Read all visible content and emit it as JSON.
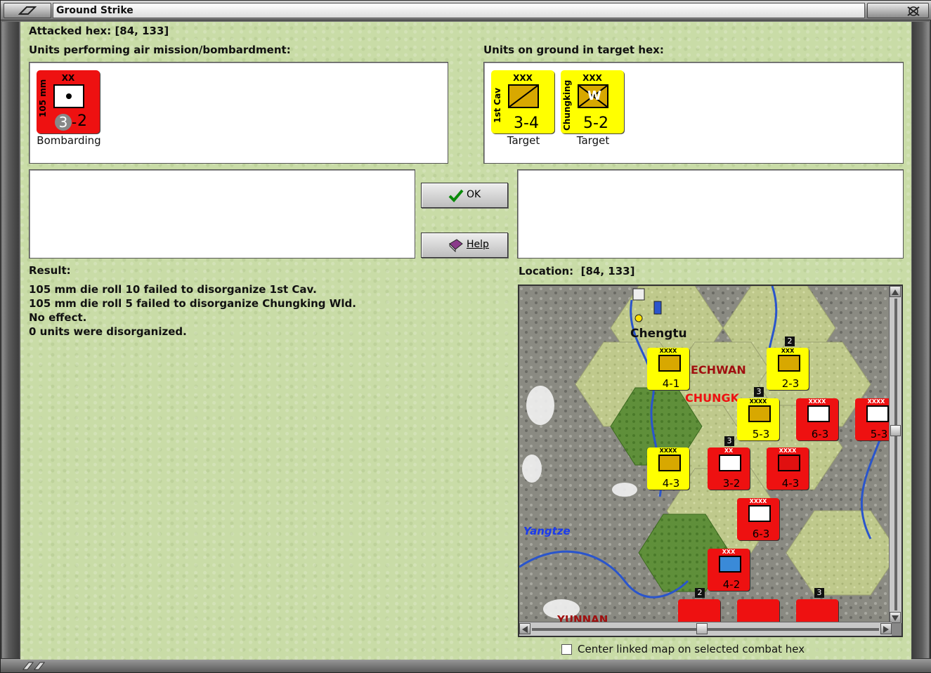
{
  "window": {
    "title": "Ground Strike"
  },
  "attacked_hex": {
    "label": "Attacked hex:",
    "value": "[84, 133]"
  },
  "air_units": {
    "heading": "Units performing air mission/bombardment:",
    "units": [
      {
        "name": "105 mm",
        "size": "XX",
        "attack": "3",
        "defense": "2",
        "status": "Bombarding",
        "color": "#ee1111"
      }
    ]
  },
  "ground_units": {
    "heading": "Units on ground in target hex:",
    "units": [
      {
        "name": "1st Cav",
        "size": "XXX",
        "strength": "3-4",
        "status": "Target",
        "color": "#ffff00"
      },
      {
        "name": "Chungking",
        "size": "XXX",
        "strength": "5-2",
        "status": "Target",
        "color": "#ffff00",
        "symbol_letter": "W"
      }
    ]
  },
  "buttons": {
    "ok": "OK",
    "help": "Help"
  },
  "result": {
    "heading": "Result:",
    "lines": [
      "105 mm die roll 10 failed to disorganize 1st Cav.",
      "105 mm die roll 5 failed to disorganize Chungking Wld.",
      "No effect.",
      "0 units were disorganized."
    ]
  },
  "location": {
    "label": "Location:",
    "value": "[84, 133]"
  },
  "map": {
    "labels": {
      "chengtu": "Chengtu",
      "echwan": "ECHWAN",
      "chungking": "CHUNGK",
      "yangtze": "Yangtze",
      "yunnan": "YUNNAN"
    },
    "counters": [
      {
        "strength": "4-1",
        "color": "yellow",
        "size": "XXXX"
      },
      {
        "strength": "2-3",
        "color": "yellow",
        "size": "XXX",
        "badge": "2"
      },
      {
        "strength": "5-3",
        "color": "yellow",
        "size": "XXXX",
        "badge": "3"
      },
      {
        "strength": "6-3",
        "color": "red",
        "size": "XXXX"
      },
      {
        "strength": "5-3",
        "color": "red",
        "size": "XXXX"
      },
      {
        "strength": "4-3",
        "color": "yellow",
        "size": "XXXX"
      },
      {
        "strength": "3-2",
        "color": "red",
        "size": "XX",
        "badge": "3"
      },
      {
        "strength": "4-3",
        "color": "red",
        "size": "XXXX"
      },
      {
        "strength": "6-3",
        "color": "red",
        "size": "XXXX"
      },
      {
        "strength": "4-2",
        "color": "red",
        "size": "XXX"
      }
    ],
    "bottom_badges": [
      "2",
      "3"
    ]
  },
  "center_checkbox": {
    "label": "Center linked map on selected combat hex",
    "checked": false
  }
}
